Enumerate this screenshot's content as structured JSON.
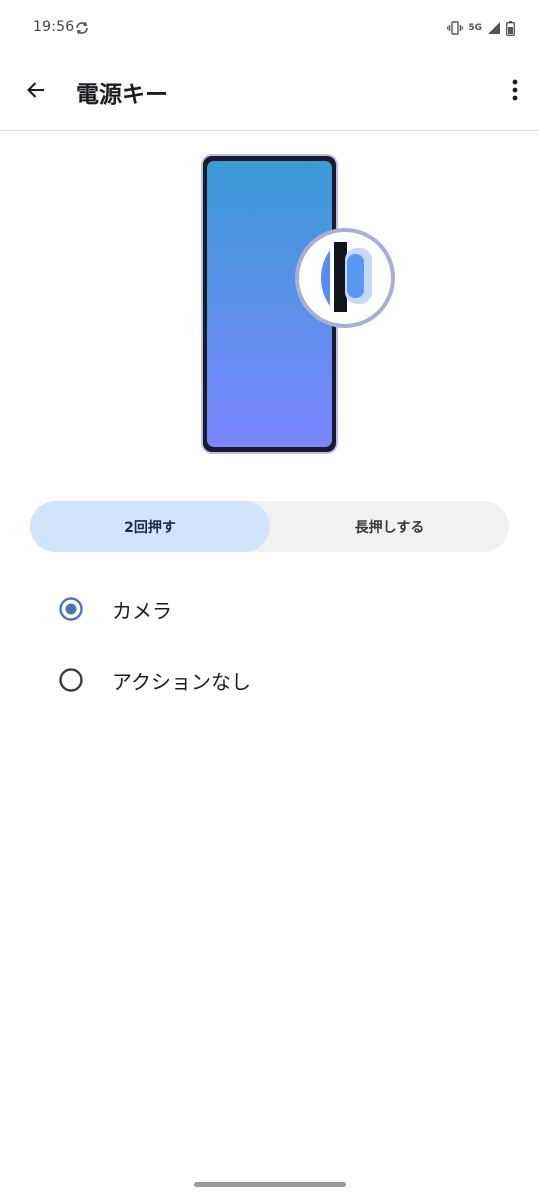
{
  "status_bar": {
    "time": "19:56",
    "network_label": "5G",
    "icons": [
      "sync-icon",
      "vibrate-icon",
      "signal-icon",
      "battery-icon"
    ]
  },
  "app_bar": {
    "title": "電源キー",
    "icons": [
      "back-arrow-icon",
      "more-vert-icon"
    ]
  },
  "segmented_control": {
    "selected_index": 0,
    "options": [
      {
        "label": "2回押す"
      },
      {
        "label": "長押しする"
      }
    ]
  },
  "options": [
    {
      "label": "カメラ",
      "selected": true
    },
    {
      "label": "アクションなし",
      "selected": false
    }
  ],
  "colors": {
    "accent": "#4f74b6",
    "selected_segment_bg": "#d2e4fb",
    "segment_track_bg": "#f2f1f1",
    "screen_gradient_top": "#3b9ad6",
    "screen_gradient_bottom": "#7b86ff"
  }
}
